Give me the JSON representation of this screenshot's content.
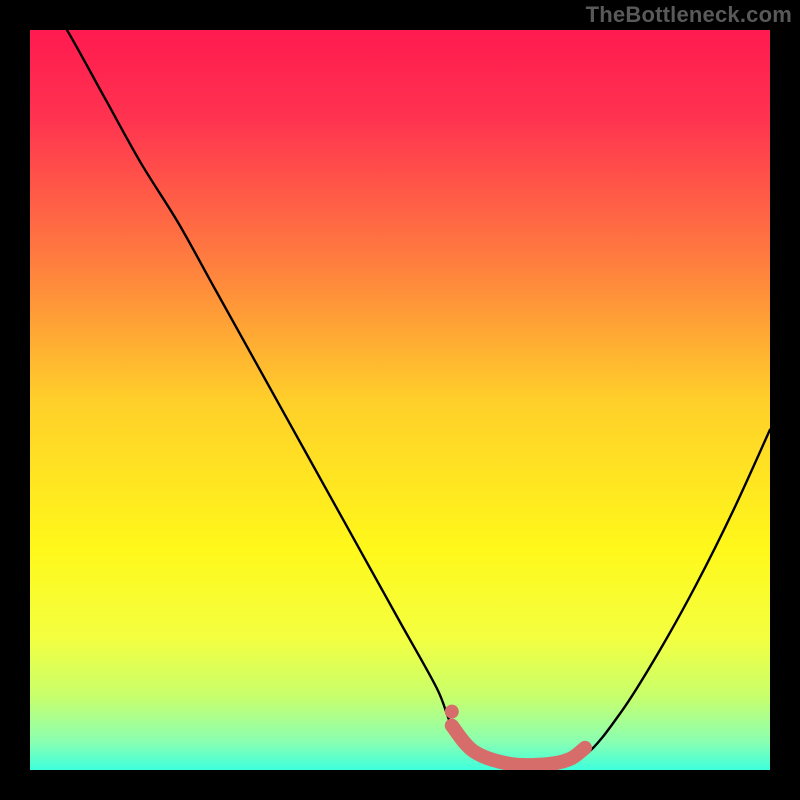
{
  "watermark": "TheBottleneck.com",
  "chart_data": {
    "type": "line",
    "title": "",
    "xlabel": "",
    "ylabel": "",
    "xlim": [
      0,
      100
    ],
    "ylim": [
      0,
      100
    ],
    "series": [
      {
        "name": "bottleneck-curve",
        "x": [
          0,
          5,
          10,
          15,
          20,
          25,
          30,
          35,
          40,
          45,
          50,
          55,
          57,
          60,
          65,
          70,
          75,
          80,
          85,
          90,
          95,
          100
        ],
        "y": [
          108,
          100,
          91,
          82,
          74,
          65,
          56,
          47,
          38,
          29,
          20,
          11,
          6,
          2,
          0.5,
          0.5,
          2,
          8,
          16,
          25,
          35,
          46
        ]
      },
      {
        "name": "highlight-segment",
        "x": [
          57,
          60,
          65,
          70,
          73,
          75
        ],
        "y": [
          6,
          2.5,
          0.8,
          0.8,
          1.5,
          3
        ]
      }
    ],
    "colors": {
      "curve": "#000000",
      "highlight": "#d76d6a",
      "gradient_stops": [
        {
          "offset": 0.0,
          "color": "#ff1a4f"
        },
        {
          "offset": 0.12,
          "color": "#ff3350"
        },
        {
          "offset": 0.3,
          "color": "#ff7840"
        },
        {
          "offset": 0.5,
          "color": "#ffcf2a"
        },
        {
          "offset": 0.7,
          "color": "#fff81a"
        },
        {
          "offset": 0.82,
          "color": "#f4ff40"
        },
        {
          "offset": 0.9,
          "color": "#c8ff6b"
        },
        {
          "offset": 0.96,
          "color": "#8cffb0"
        },
        {
          "offset": 1.0,
          "color": "#3effdd"
        }
      ]
    }
  }
}
